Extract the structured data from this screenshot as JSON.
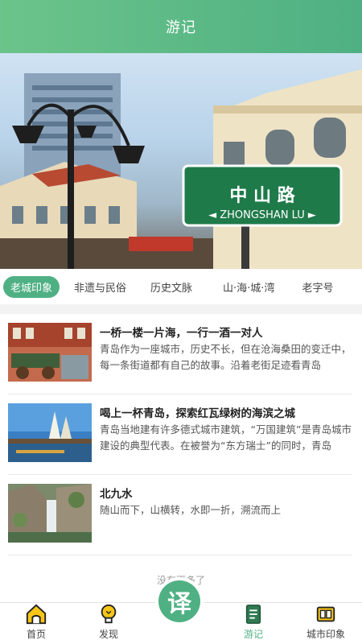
{
  "header": {
    "title": "游记"
  },
  "banner": {
    "sign_chinese": "中 山 路",
    "sign_pinyin": "◄ ZHONGSHAN LU ►"
  },
  "tabs": [
    {
      "label": "老城印象",
      "active": true
    },
    {
      "label": "非遗与民俗",
      "active": false
    },
    {
      "label": "历史文脉",
      "active": false
    },
    {
      "label": "山·海·城·湾",
      "active": false
    },
    {
      "label": "老字号",
      "active": false
    }
  ],
  "articles": [
    {
      "title": "一桥一楼一片海，一行一酒一对人",
      "desc": "青岛作为一座城市，历史不长，但在沧海桑田的变迁中，每一条街道都有自己的故事。沿着老街足迹看青岛"
    },
    {
      "title": "喝上一杯青岛，探索红瓦绿树的海滨之城",
      "desc": "青岛当地建有许多德式城市建筑，“万国建筑”是青岛城市建设的典型代表。在被誉为“东方瑞士”的同时，青岛"
    },
    {
      "title": "北九水",
      "desc": "随山而下，山横转，水即一折，溯流而上"
    }
  ],
  "footer_note": "没有更多了",
  "tabbar": {
    "items": [
      {
        "label": "首页",
        "icon": "home-icon",
        "active": false
      },
      {
        "label": "发现",
        "icon": "lightbulb-icon",
        "active": false
      },
      {
        "label": "游记",
        "icon": "notebook-icon",
        "active": true
      },
      {
        "label": "城市印象",
        "icon": "film-strip-icon",
        "active": false
      }
    ],
    "center_button": {
      "glyph": "译"
    }
  },
  "colors": {
    "accent": "#4fb083",
    "header_gradient_start": "#6bc48a"
  }
}
